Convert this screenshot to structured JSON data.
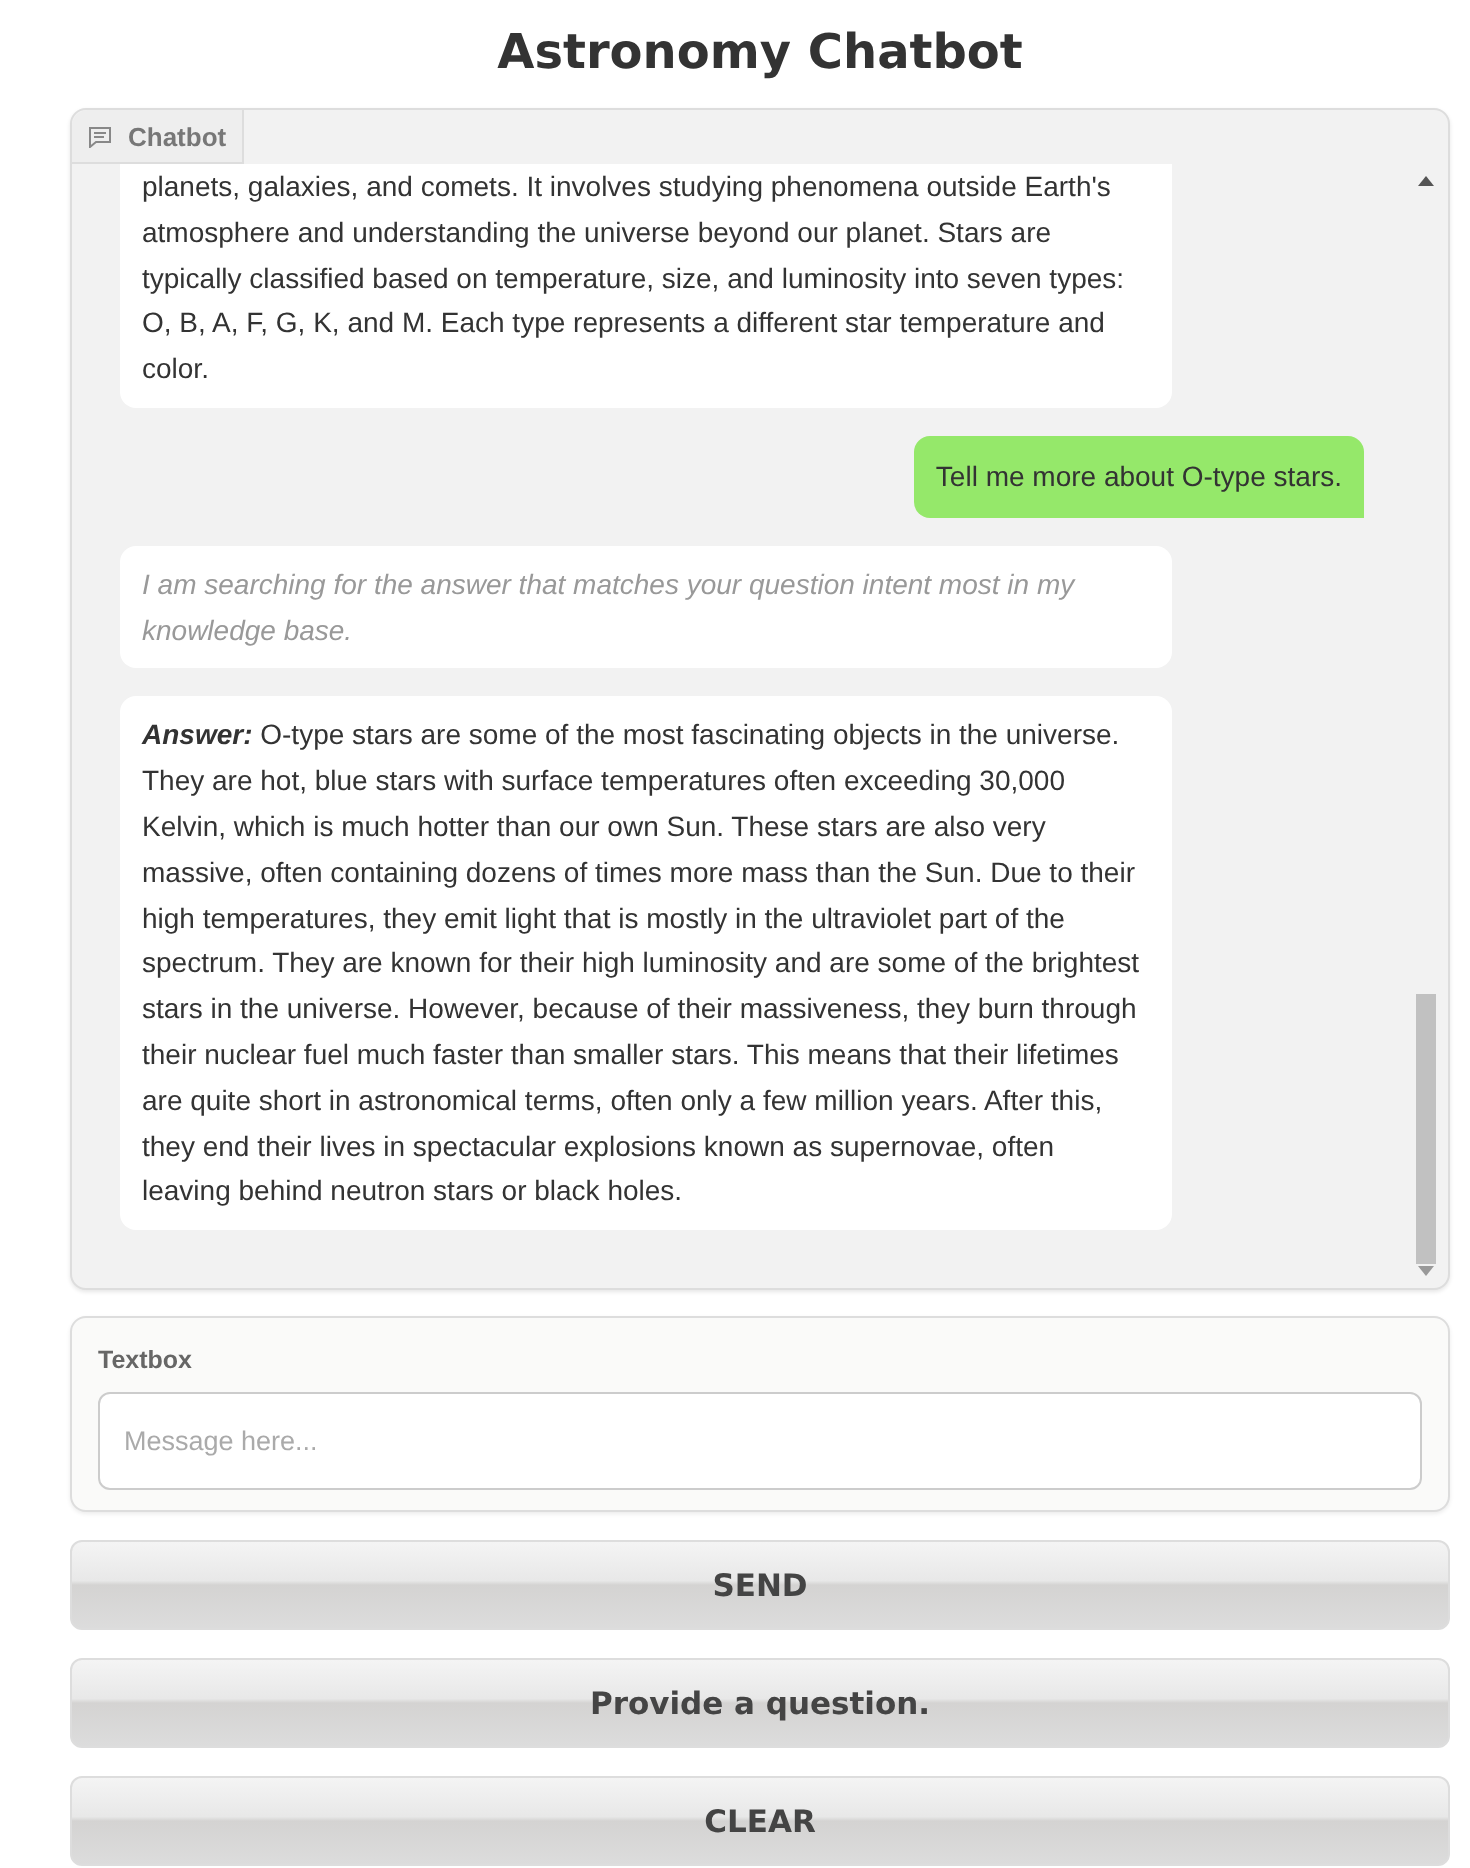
{
  "title": "Astronomy Chatbot",
  "chatbot": {
    "label": "Chatbot",
    "messages": [
      {
        "kind": "bot",
        "text": "planets, galaxies, and comets. It involves studying phenomena outside Earth's atmosphere and understanding the universe beyond our planet. Stars are typically classified based on temperature, size, and luminosity into seven types: O, B, A, F, G, K, and M. Each type represents a different star temperature and color."
      },
      {
        "kind": "user",
        "text": "Tell me more about O-type stars."
      },
      {
        "kind": "status",
        "text": "I am searching for the answer that matches your question intent most in my knowledge base."
      },
      {
        "kind": "bot",
        "text": "**Answer:** O-type stars are some of the most fascinating objects in the universe. They are hot, blue stars with surface temperatures often exceeding 30,000 Kelvin, which is much hotter than our own Sun. These stars are also very massive, often containing dozens of times more mass than the Sun. Due to their high temperatures, they emit light that is mostly in the ultraviolet part of the spectrum. They are known for their high luminosity and are some of the brightest stars in the universe. However, because of their massiveness, they burn through their nuclear fuel much faster than smaller stars. This means that their lifetimes are quite short in astronomical terms, often only a few million years. After this, they end their lives in spectacular explosions known as supernovae, often leaving behind neutron stars or black holes."
      }
    ]
  },
  "textbox": {
    "label": "Textbox",
    "placeholder": "Message here..."
  },
  "buttons": [
    "SEND",
    "Provide a question.",
    "CLEAR"
  ]
}
